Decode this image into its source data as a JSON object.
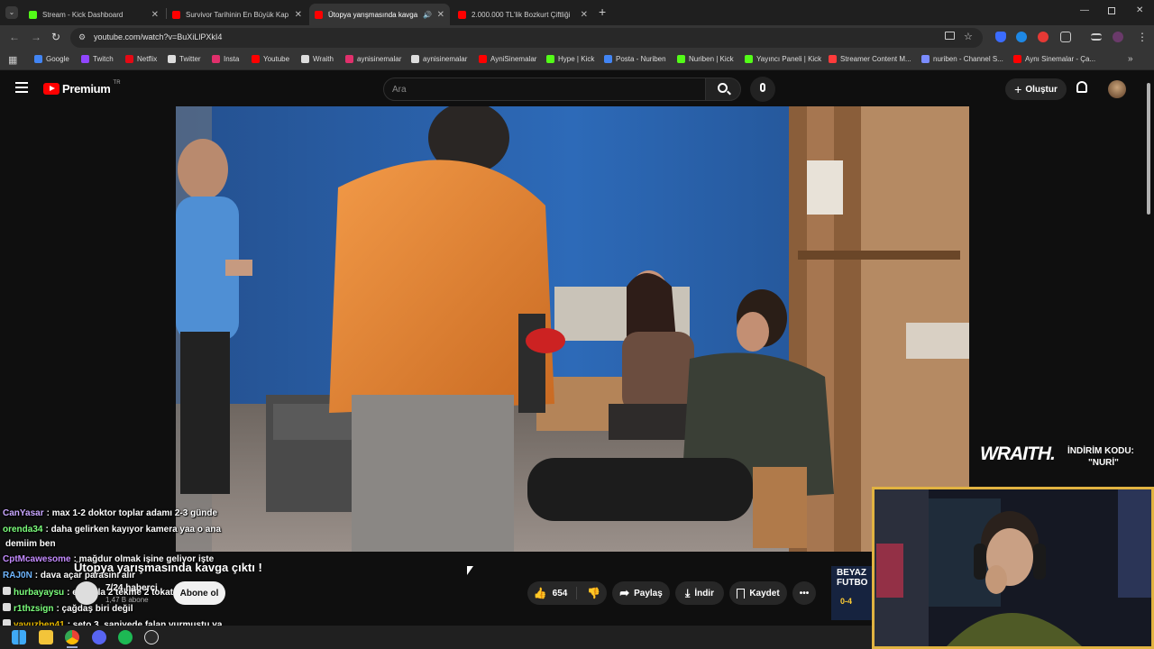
{
  "tabs": [
    {
      "label": "Stream - Kick Dashboard",
      "fav_color": "#53fc18"
    },
    {
      "label": "Survivor Tarihinin En Büyük Kap",
      "fav_color": "#ff0000"
    },
    {
      "label": "Ütopya yarışmasında kavga",
      "fav_color": "#ff0000"
    },
    {
      "label": "2.000.000 TL'lik Bozkurt Çiftliği",
      "fav_color": "#ff0000"
    }
  ],
  "address": {
    "url": "youtube.com/watch?v=BuXiLlPXkI4"
  },
  "bookmarks": [
    {
      "label": "Google",
      "color": "#4285f4"
    },
    {
      "label": "Twitch",
      "color": "#9146ff"
    },
    {
      "label": "Netflix",
      "color": "#e50914"
    },
    {
      "label": "Twitter",
      "color": "#dddddd"
    },
    {
      "label": "Insta",
      "color": "#e1306c"
    },
    {
      "label": "Youtube",
      "color": "#ff0000"
    },
    {
      "label": "Wraith",
      "color": "#dddddd"
    },
    {
      "label": "aynisinemalar",
      "color": "#e1306c"
    },
    {
      "label": "aynisinemalar",
      "color": "#dddddd"
    },
    {
      "label": "AyniSinemalar",
      "color": "#ff0000"
    },
    {
      "label": "Hype | Kick",
      "color": "#53fc18"
    },
    {
      "label": "Posta - Nuriben",
      "color": "#4285f4"
    },
    {
      "label": "Nuriben | Kick",
      "color": "#53fc18"
    },
    {
      "label": "Yayıncı Paneli | Kick",
      "color": "#53fc18"
    },
    {
      "label": "Streamer Content M...",
      "color": "#ff3b3b"
    },
    {
      "label": "nuriben - Channel S...",
      "color": "#7b8cff"
    },
    {
      "label": "Aynı Sinemalar - Ça...",
      "color": "#ff0000"
    }
  ],
  "youtube": {
    "logo_text": "Premium",
    "logo_sup": "TR",
    "search_placeholder": "Ara",
    "create_label": "Oluştur"
  },
  "sponsor": {
    "brand": "WRAITH.",
    "line1": "İNDİRİM KODU:",
    "line2": "\"NURİ\""
  },
  "chat": [
    {
      "user": "CanYasar",
      "color": "#c9a7ff",
      "text": ": max 1-2 doktor toplar adamı 2-3 günde"
    },
    {
      "user": "orenda34",
      "color": "#7cff7c",
      "text": ": daha gelirken kayıyor kamera yaa o ana"
    },
    {
      "user": "",
      "color": "#ffffff",
      "text": "demiim ben"
    },
    {
      "user": "CptMcawesome",
      "color": "#c48bff",
      "text": ": mağdur olmak işine geliyor işte"
    },
    {
      "user": "RAJ0N",
      "color": "#6fb6ff",
      "text": ": dava açar parasını alır"
    },
    {
      "user": "hurbayaysu",
      "color": "#7cff7c",
      "text": ": en fazla 2 tekme 2 tokat"
    },
    {
      "user": "r1thzsign",
      "color": "#7cff7c",
      "text": ": çağdaş biri değil"
    },
    {
      "user": "yavuzben41",
      "color": "#e6b800",
      "text": ": seto 3. saniyede falan vurmuştu ya"
    }
  ],
  "video": {
    "title": "Ütopya yarışmasında kavga çıktı !",
    "channel": "7/24 haberci",
    "subscribers": "1,47 B abone",
    "subscribe_label": "Abone ol",
    "likes": "654",
    "share_label": "Paylaş",
    "download_label": "İndir",
    "save_label": "Kaydet"
  },
  "ad_thumb": {
    "line1": "BEYAZ",
    "line2": "FUTBO",
    "score": "0-4"
  }
}
